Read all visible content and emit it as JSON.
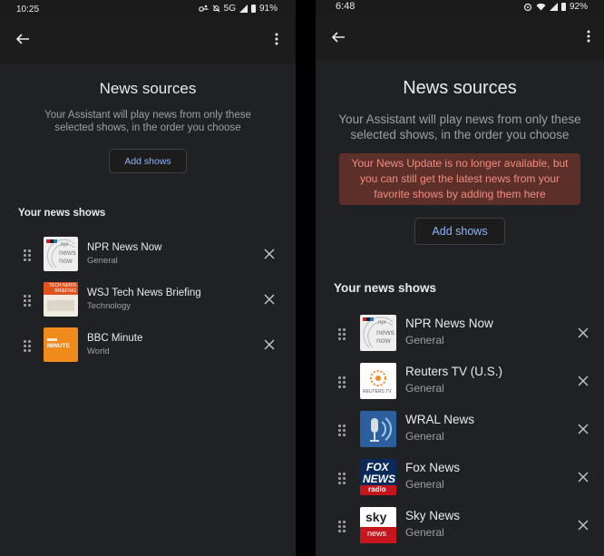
{
  "left": {
    "status": {
      "time": "10:25",
      "network": "5G",
      "battery": "91%"
    },
    "page_title": "News sources",
    "subtitle": "Your Assistant will play news from only these selected shows, in the order you choose",
    "add_shows_label": "Add shows",
    "section_title": "Your news shows",
    "shows": [
      {
        "name": "NPR News Now",
        "category": "General",
        "logo": "npr-news-now-logo"
      },
      {
        "name": "WSJ Tech News Briefing",
        "category": "Technology",
        "logo": "wsj-tech-news-logo"
      },
      {
        "name": "BBC Minute",
        "category": "World",
        "logo": "bbc-minute-logo"
      }
    ]
  },
  "right": {
    "status": {
      "time": "6:48",
      "battery": "92%"
    },
    "page_title": "News sources",
    "subtitle": "Your Assistant will play news from only these selected shows, in the order you choose",
    "warning": "Your News Update is no longer available, but you can still get the latest news from your favorite shows by adding them here",
    "add_shows_label": "Add shows",
    "section_title": "Your news shows",
    "shows": [
      {
        "name": "NPR News Now",
        "category": "General",
        "logo": "npr-news-now-logo"
      },
      {
        "name": "Reuters TV (U.S.)",
        "category": "General",
        "logo": "reuters-tv-logo"
      },
      {
        "name": "WRAL News",
        "category": "General",
        "logo": "wral-news-logo"
      },
      {
        "name": "Fox News",
        "category": "General",
        "logo": "fox-news-radio-logo"
      },
      {
        "name": "Sky News",
        "category": "General",
        "logo": "sky-news-logo"
      }
    ]
  },
  "logo_text": {
    "npr_small": "npr",
    "npr_news": "news",
    "npr_now": "now",
    "wsj_top": "TECH NEWS BRIEFING",
    "bbc": "MINUTE",
    "reuters": "REUTERS TV",
    "fox_top": "FOX",
    "fox_mid": "NEWS",
    "fox_bottom": "radio",
    "sky_top": "sky",
    "sky_bottom": "news"
  },
  "colors": {
    "background": "#202124",
    "accent_link": "#8ab4f8",
    "warning_bg": "#5c2f28",
    "warning_text": "#f28b82"
  }
}
